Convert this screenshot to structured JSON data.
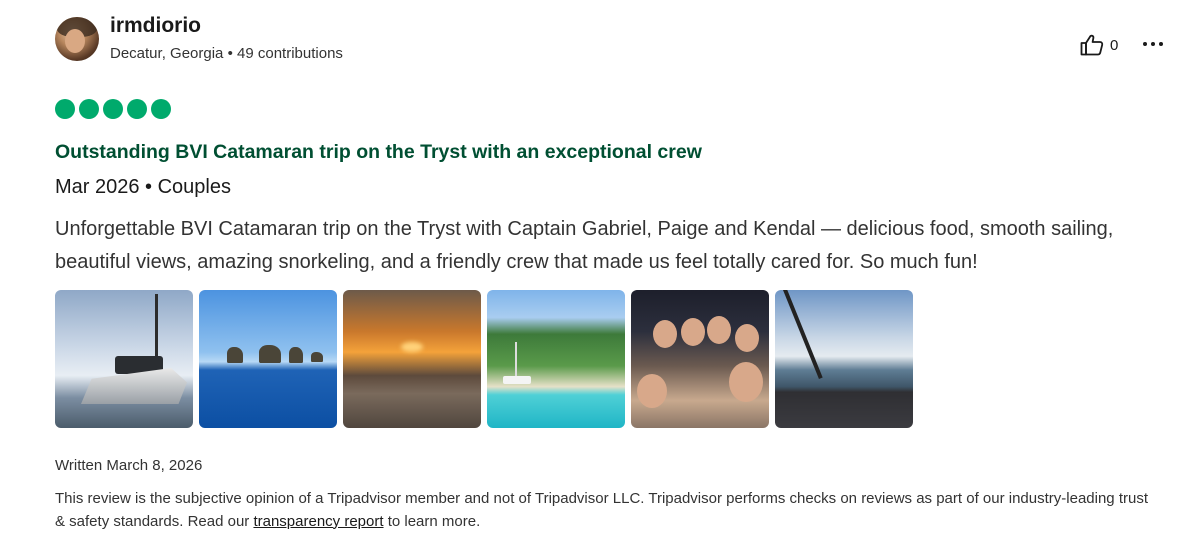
{
  "user": {
    "name": "irmdiorio",
    "location": "Decatur, Georgia",
    "separator": "•",
    "contributions": "49 contributions"
  },
  "helpful": {
    "count": "0",
    "icon": "thumbs-up-icon"
  },
  "more_icon": "more-dots-icon",
  "rating": {
    "value": 5,
    "max": 5,
    "color": "#00aa6c"
  },
  "review": {
    "title": "Outstanding BVI Catamaran trip on the Tryst with an exceptional crew",
    "trip_info": "Mar 2026 • Couples",
    "text": "Unforgettable BVI Catamaran trip on the Tryst with Captain Gabriel, Paige and Kendal — delicious food, smooth sailing, beautiful views, amazing snorkeling, and a friendly crew that made us feel totally cared for. So much fun!",
    "title_color": "#004f32"
  },
  "photos_count": 6,
  "written": "Written March 8, 2026",
  "disclaimer": {
    "text_before": "This review is the subjective opinion of a Tripadvisor member and not of Tripadvisor LLC. Tripadvisor performs checks on reviews as part of our industry-leading trust & safety standards. Read our ",
    "link": "transparency report",
    "text_after": " to learn more."
  }
}
